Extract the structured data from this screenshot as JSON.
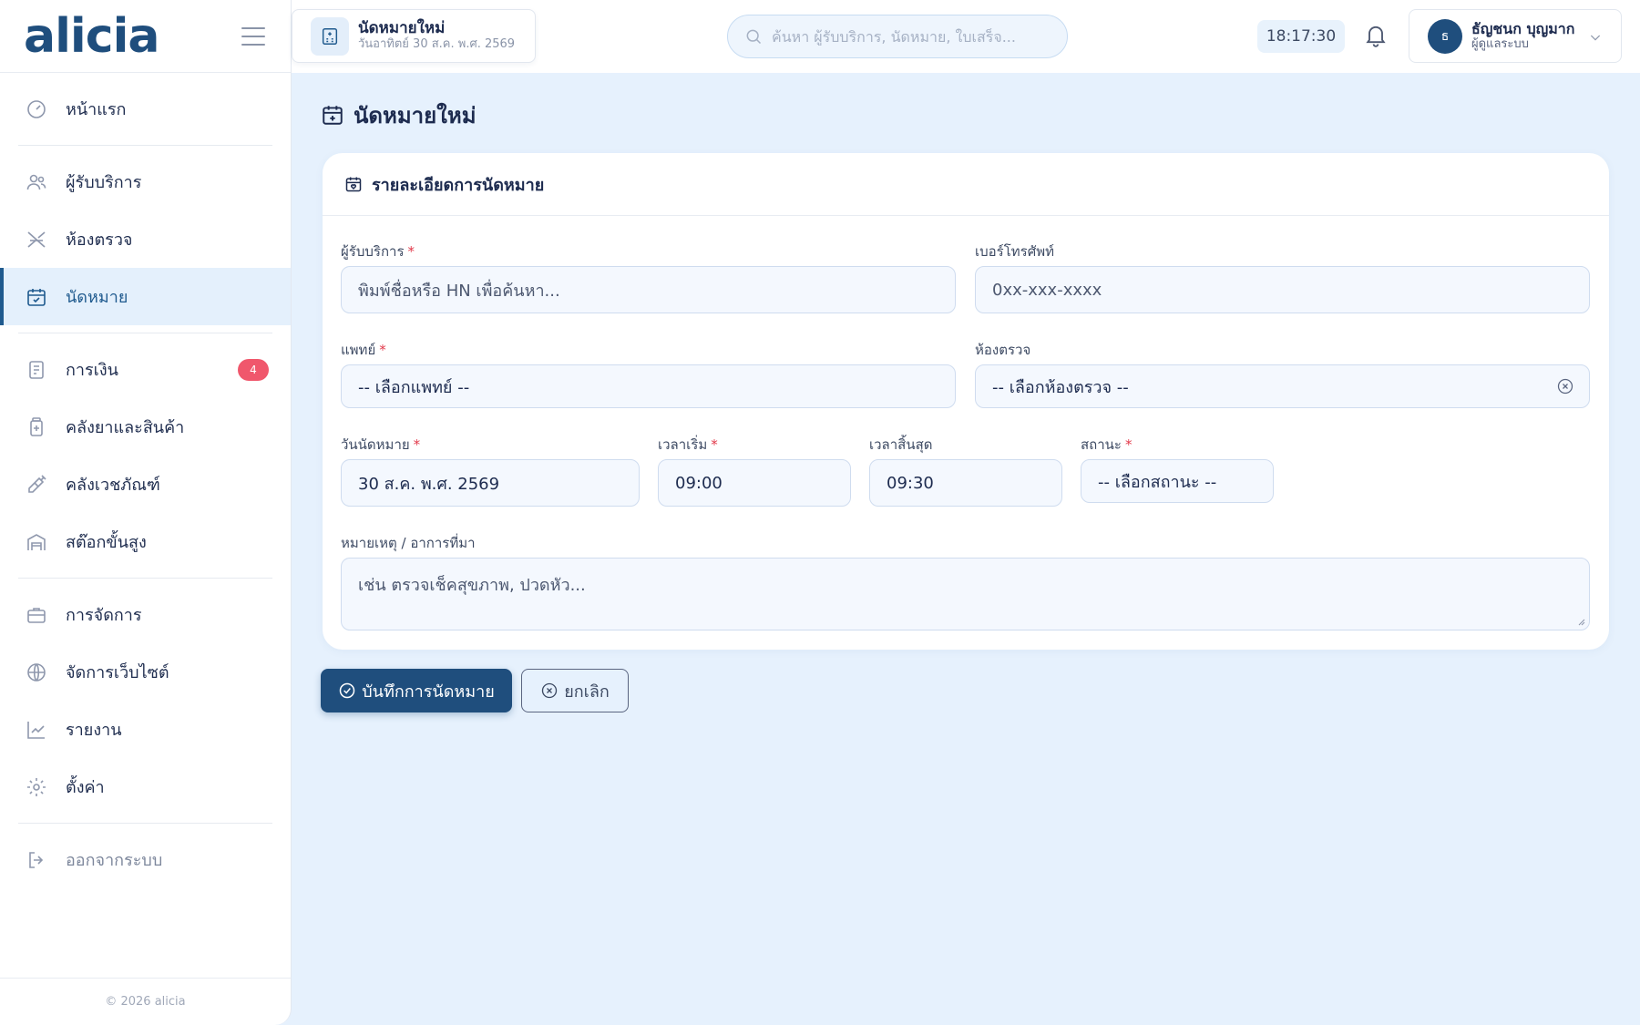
{
  "brand": {
    "logo": "alicia"
  },
  "sidebar": {
    "items": [
      {
        "label": "หน้าแรก",
        "icon": "dashboard-icon"
      },
      {
        "label": "ผู้รับบริการ",
        "icon": "users-icon"
      },
      {
        "label": "ห้องตรวจ",
        "icon": "exam-room-icon"
      },
      {
        "label": "นัดหมาย",
        "icon": "calendar-check-icon",
        "active": true
      },
      {
        "label": "การเงิน",
        "icon": "receipt-icon",
        "badge": "4"
      },
      {
        "label": "คลังยาและสินค้า",
        "icon": "medicine-bottle-icon"
      },
      {
        "label": "คลังเวชภัณฑ์",
        "icon": "syringe-icon"
      },
      {
        "label": "สต๊อกขั้นสูง",
        "icon": "warehouse-icon"
      },
      {
        "label": "การจัดการ",
        "icon": "briefcase-icon"
      },
      {
        "label": "จัดการเว็บไซต์",
        "icon": "globe-icon"
      },
      {
        "label": "รายงาน",
        "icon": "chart-line-icon"
      },
      {
        "label": "ตั้งค่า",
        "icon": "gear-icon"
      },
      {
        "label": "ออกจากระบบ",
        "icon": "logout-icon"
      }
    ],
    "footer": "© 2026 alicia"
  },
  "topbar": {
    "crumb_title": "นัดหมายใหม่",
    "crumb_sub": "วันอาทิตย์ 30 ส.ค. พ.ศ. 2569",
    "search_placeholder": "ค้นหา ผู้รับบริการ, นัดหมาย, ใบเสร็จ...",
    "clock": "18:17:30",
    "user_initial": "ธ",
    "user_name": "ธัญชนก บุญมาก",
    "user_role": "ผู้ดูแลระบบ"
  },
  "page": {
    "title": "นัดหมายใหม่"
  },
  "form": {
    "section_title": "รายละเอียดการนัดหมาย",
    "patient_label": "ผู้รับบริการ",
    "patient_placeholder": "พิมพ์ชื่อหรือ HN เพื่อค้นหา...",
    "phone_label": "เบอร์โทรศัพท์",
    "phone_placeholder": "0xx-xxx-xxxx",
    "doctor_label": "แพทย์",
    "doctor_value": "-- เลือกแพทย์ --",
    "room_label": "ห้องตรวจ",
    "room_value": "-- เลือกห้องตรวจ --",
    "date_label": "วันนัดหมาย",
    "date_value": "30 ส.ค. พ.ศ. 2569",
    "start_label": "เวลาเริ่ม",
    "start_value": "09:00",
    "end_label": "เวลาสิ้นสุด",
    "end_value": "09:30",
    "status_label": "สถานะ",
    "status_value": "-- เลือกสถานะ --",
    "notes_label": "หมายเหตุ / อาการที่มา",
    "notes_placeholder": "เช่น ตรวจเช็คสุขภาพ, ปวดหัว...",
    "required_mark": "*",
    "save_label": "บันทึกการนัดหมาย",
    "cancel_label": "ยกเลิก"
  },
  "colors": {
    "primary": "#1f4e7d",
    "accent": "#1f5a8e",
    "badge": "#f0576c",
    "page_bg": "#e6f1fd"
  }
}
